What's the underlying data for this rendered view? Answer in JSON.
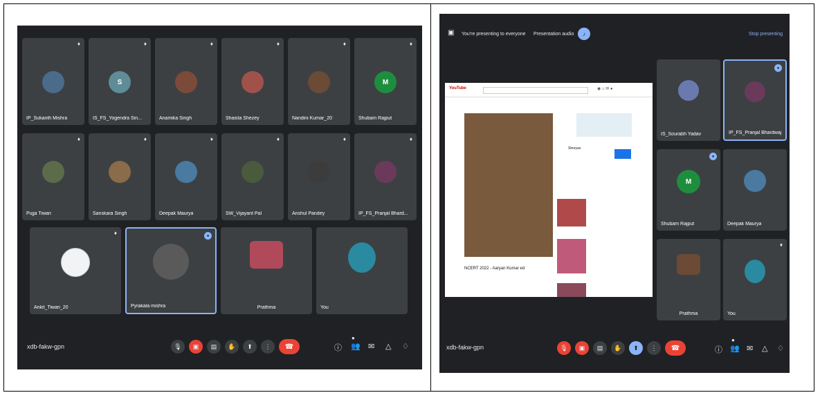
{
  "left_panel": {
    "meeting_code": "xdb-fakw-gpn",
    "rows": [
      [
        {
          "name": "IP_Sukanth Mishra",
          "avatar_color": "#4a6b8a"
        },
        {
          "name": "IS_FS_Yogendra Sin...",
          "avatar_color": "#5f8c96",
          "initial": "S"
        },
        {
          "name": "Anamika Singh",
          "avatar_color": "#7c4a3a"
        },
        {
          "name": "Shaista Shezey",
          "avatar_color": "#a0524a"
        },
        {
          "name": "Nandini Kumar_20",
          "avatar_color": "#6b4a36"
        },
        {
          "name": "Shubam Rajput",
          "avatar_color": "#1e8e3e",
          "initial": "M"
        }
      ],
      [
        {
          "name": "Pujja Tiwari",
          "avatar_color": "#5c6b4a"
        },
        {
          "name": "Sanskara Singh",
          "avatar_color": "#8a6b4a"
        },
        {
          "name": "Deepak Maurya",
          "avatar_color": "#4a7aa0"
        },
        {
          "name": "SW_Vijayant Pal",
          "avatar_color": "#4a5a3c"
        },
        {
          "name": "Anshul Pandey",
          "avatar_color": "#3c3c3c"
        },
        {
          "name": "IP_FS_Pranjal Bhard...",
          "avatar_color": "#6b3a5a"
        }
      ]
    ],
    "bottom_row": [
      {
        "name": "Ankit_Tiwari_20",
        "avatar_color": "#f1f3f4"
      },
      {
        "name": "Pyrakala mishra",
        "avatar_color": "#5a5a5a"
      },
      {
        "name": "Prathma",
        "avatar_color": "#b04a5a"
      },
      {
        "name": "You",
        "avatar_color": "#2a8aa0"
      }
    ]
  },
  "right_panel": {
    "meeting_code": "xdb-fakw-gpn",
    "present_label": "You're presenting to everyone",
    "present_audio_label": "Presentation audio",
    "stop_label": "Stop presenting",
    "yt_logo": "YouTube",
    "yt_video_title": "NCERT 2022 - Aaryan Kumar ed",
    "yt_channel": "Shreyas",
    "tiles": [
      {
        "name": "IS_Sourabh Yadav",
        "avatar_color": "#6a7ab0"
      },
      {
        "name": "IP_FS_Pranjal Bhardwaj",
        "avatar_color": "#6b3a5a"
      },
      {
        "name": "Shubam Rajput",
        "avatar_color": "#1e8e3e",
        "initial": "M"
      },
      {
        "name": "Deepak Maurya",
        "avatar_color": "#4a7aa0"
      },
      {
        "name": "Prathma",
        "avatar_color": "#6b4a36"
      },
      {
        "name": "You",
        "avatar_color": "#2a8aa0"
      }
    ]
  }
}
